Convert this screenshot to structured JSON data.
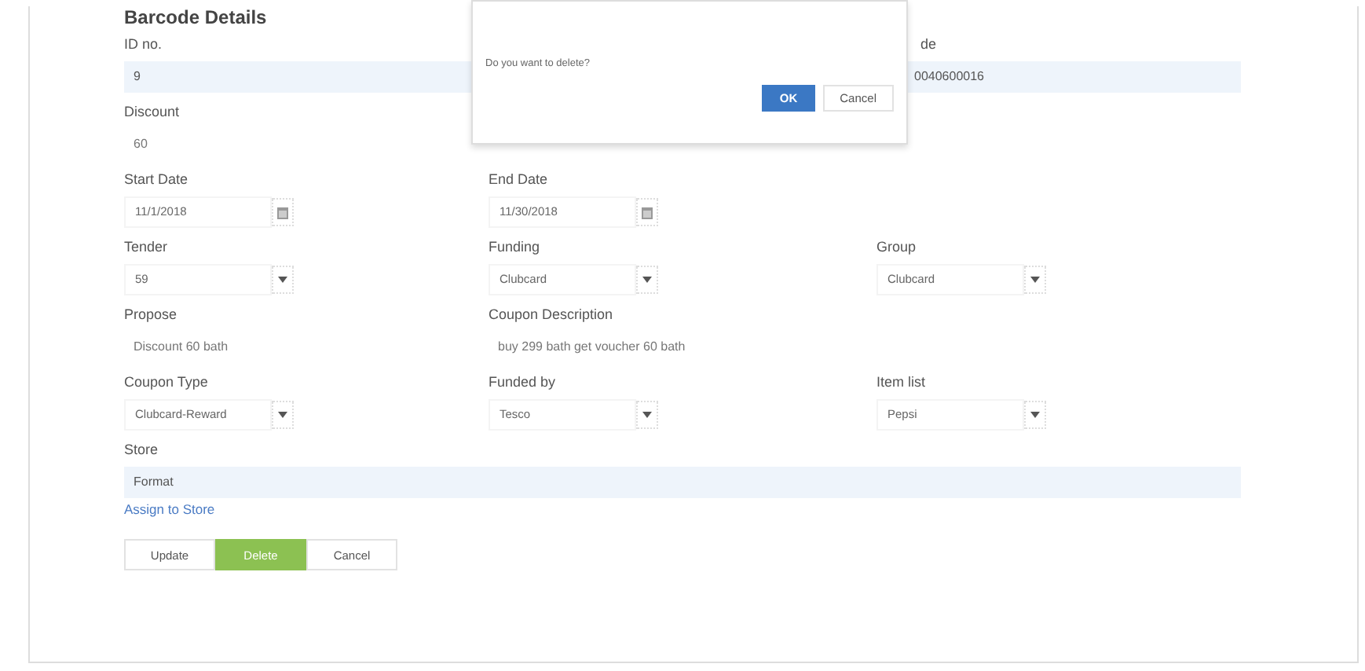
{
  "title": "Barcode Details",
  "rows": [
    {
      "fields": [
        {
          "label": "ID no.",
          "value": "9",
          "kind": "filled"
        },
        {
          "label": "de",
          "value": "0040600016",
          "kind": "filled"
        }
      ]
    },
    {
      "fields": [
        {
          "label": "Discount",
          "value": "60",
          "kind": "plain"
        }
      ]
    },
    {
      "fields": [
        {
          "label": "Start Date",
          "value": "11/1/2018",
          "kind": "date"
        },
        {
          "label": "End Date",
          "value": "11/30/2018",
          "kind": "date"
        }
      ]
    },
    {
      "fields": [
        {
          "label": "Tender",
          "value": "59",
          "kind": "select"
        },
        {
          "label": "Funding",
          "value": "Clubcard",
          "kind": "select"
        },
        {
          "label": "Group",
          "value": "Clubcard",
          "kind": "select"
        }
      ]
    },
    {
      "fields": [
        {
          "label": "Propose",
          "value": "Discount 60 bath",
          "kind": "plain"
        },
        {
          "label": "Coupon Description",
          "value": "buy 299 bath get voucher 60 bath",
          "kind": "plain"
        }
      ]
    },
    {
      "fields": [
        {
          "label": "Coupon Type",
          "value": "Clubcard-Reward",
          "kind": "select"
        },
        {
          "label": "Funded by",
          "value": "Tesco",
          "kind": "select"
        },
        {
          "label": "Item list",
          "value": "Pepsi",
          "kind": "select"
        }
      ]
    },
    {
      "fields": [
        {
          "label": "Store",
          "value": "Format",
          "kind": "filled"
        }
      ]
    }
  ],
  "link": "Assign to Store",
  "buttons": [
    {
      "label": "Update",
      "kind": "default"
    },
    {
      "label": "Delete",
      "kind": "success"
    },
    {
      "label": "Cancel",
      "kind": "default"
    }
  ],
  "dialog": {
    "message": "Do you want to delete?",
    "buttons": [
      {
        "label": "OK",
        "kind": "primary"
      },
      {
        "label": "Cancel",
        "kind": "default"
      }
    ]
  }
}
